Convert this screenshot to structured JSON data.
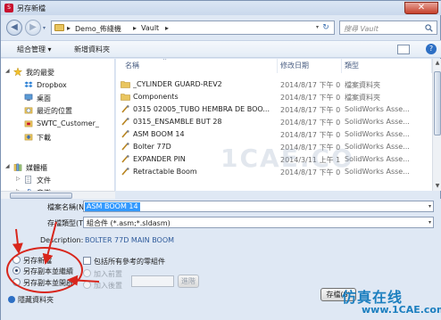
{
  "window": {
    "title": "另存新檔",
    "app_icon": "solidworks-icon",
    "close_glyph": "✕"
  },
  "nav": {
    "back_glyph": "◀",
    "forward_glyph": "▶",
    "path": [
      "Demo_佈綫機",
      "Vault"
    ],
    "separator": "▸",
    "search_placeholder": "搜尋 Vault"
  },
  "toolbar": {
    "organize_label": "組合管理 ▾",
    "new_folder_label": "新增資料夾",
    "help_glyph": "?"
  },
  "sidebar": {
    "items": [
      {
        "label": "我的最愛",
        "icon": "star-icon",
        "expand": "◢"
      },
      {
        "label": "Dropbox",
        "icon": "dropbox-icon"
      },
      {
        "label": "桌面",
        "icon": "desktop-icon"
      },
      {
        "label": "最近的位置",
        "icon": "recent-places-icon"
      },
      {
        "label": "SWTC_Customer_",
        "icon": "vault-icon"
      },
      {
        "label": "下載",
        "icon": "download-icon"
      },
      {
        "label": "媒體櫃",
        "icon": "library-icon",
        "expand": "◢"
      },
      {
        "label": "文件",
        "icon": "documents-icon",
        "expand": "▷"
      },
      {
        "label": "音樂",
        "icon": "music-icon",
        "expand": "▷"
      }
    ]
  },
  "filelist": {
    "columns": {
      "name": "名稱",
      "date": "修改日期",
      "type": "類型",
      "sort_caret": "^"
    },
    "rows": [
      {
        "name": "_CYLINDER GUARD-REV2",
        "date": "2014/8/17 下午 0...",
        "type": "檔案資料夾",
        "icon": "folder-icon"
      },
      {
        "name": "Components",
        "date": "2014/8/17 下午 0...",
        "type": "檔案資料夾",
        "icon": "folder-icon"
      },
      {
        "name": "0315 02005_TUBO HEMBRA DE BOO...",
        "date": "2014/8/17 下午 0...",
        "type": "SolidWorks Asse...",
        "icon": "assembly-icon"
      },
      {
        "name": "0315_ENSAMBLE BUT 28",
        "date": "2014/8/17 下午 0...",
        "type": "SolidWorks Asse...",
        "icon": "assembly-icon"
      },
      {
        "name": "ASM BOOM 14",
        "date": "2014/8/17 下午 0...",
        "type": "SolidWorks Asse...",
        "icon": "assembly-icon"
      },
      {
        "name": "Bolter 77D",
        "date": "2014/8/17 下午 0...",
        "type": "SolidWorks Asse...",
        "icon": "assembly-icon"
      },
      {
        "name": "EXPANDER PIN",
        "date": "2014/3/11 上午 1...",
        "type": "SolidWorks Asse...",
        "icon": "assembly-icon"
      },
      {
        "name": "Retractable Boom",
        "date": "2014/8/17 下午 0...",
        "type": "SolidWorks Asse...",
        "icon": "assembly-icon"
      }
    ]
  },
  "scroll": {
    "up": "▲",
    "down": "▼"
  },
  "form": {
    "filename_label": "檔案名稱(N):",
    "filename_value": "ASM BOOM 14",
    "savetype_label": "存檔類型(T):",
    "savetype_value": "組合件 (*.asm;*.sldasm)",
    "description_label": "Description:",
    "description_value": "BOLTER 77D MAIN BOOM",
    "radio_save_as": "另存新檔",
    "radio_save_copy_continue": "另存副本並繼續",
    "radio_save_copy_open": "另存副本並開啟",
    "checkbox_include_refs": "包括所有參考的零組件",
    "add_prefix": "加入前置",
    "add_suffix": "加入後置",
    "advanced_button": "進階",
    "save_button": "存檔(S)",
    "hide_folders": "隱藏資料夾",
    "drop_glyph": "▾"
  },
  "selection": {
    "save_mode": "copy_continue"
  },
  "watermark": {
    "center": "1CAE.CO",
    "brand_cn": "仿真在线",
    "brand_url": "www.1CAE.com"
  },
  "colors": {
    "accent": "#3399ff",
    "annotation": "#d8261c",
    "brand": "#1c7fbf"
  }
}
